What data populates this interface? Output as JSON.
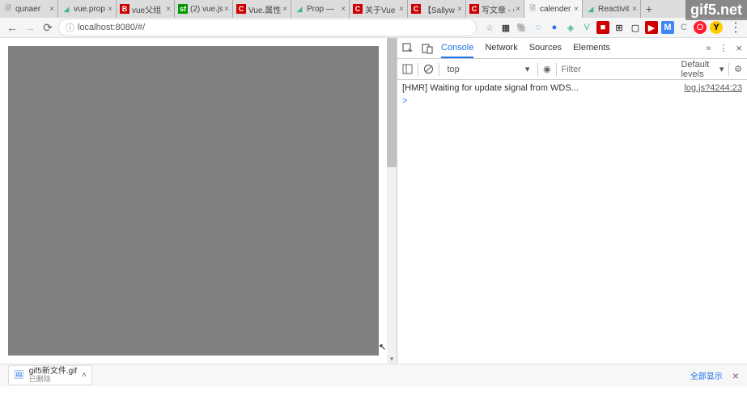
{
  "watermark": "gif5.net",
  "tabs": [
    {
      "title": "qunaer",
      "favicon": "doc"
    },
    {
      "title": "vue.prop",
      "favicon": "vue"
    },
    {
      "title": "vue父组",
      "favicon": "csdn"
    },
    {
      "title": "(2) vue.js",
      "favicon": "sf"
    },
    {
      "title": "Vue.属性",
      "favicon": "csdn"
    },
    {
      "title": "Prop —",
      "favicon": "vue"
    },
    {
      "title": "关于Vue",
      "favicon": "csdn"
    },
    {
      "title": "【Sallyw",
      "favicon": "csdn"
    },
    {
      "title": "写文章 - C",
      "favicon": "csdn"
    },
    {
      "title": "calender",
      "favicon": "doc",
      "active": true
    },
    {
      "title": "Reactivit",
      "favicon": "vue"
    }
  ],
  "url": "localhost:8080/#/",
  "devtools": {
    "tabs": [
      "Console",
      "Network",
      "Sources",
      "Elements"
    ],
    "active_tab": "Console",
    "more": "»",
    "context": "top",
    "filter_placeholder": "Filter",
    "levels": "Default levels",
    "log_msg": "[HMR] Waiting for update signal from WDS...",
    "log_src": "log.js?4244:23",
    "prompt": ">"
  },
  "download": {
    "name": "gif5新文件.gif",
    "status": "已删除",
    "showall": "全部显示"
  }
}
